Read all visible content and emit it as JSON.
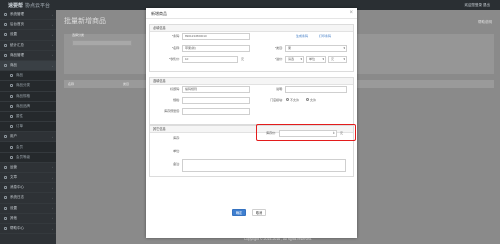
{
  "header": {
    "brand": "速要帮",
    "brand_sub": "协点云平台",
    "user_text": "欢迎您登录 退出"
  },
  "sidebar": {
    "items": [
      {
        "label": "系统管理",
        "type": "top"
      },
      {
        "label": "后台首页",
        "type": "top"
      },
      {
        "label": "设置",
        "type": "top"
      },
      {
        "label": "统计汇总",
        "type": "top"
      },
      {
        "label": "商品管理",
        "type": "top"
      },
      {
        "label": "商品",
        "type": "top",
        "active": true
      },
      {
        "label": "商品",
        "type": "sub"
      },
      {
        "label": "商品分类",
        "type": "sub"
      },
      {
        "label": "商品规格",
        "type": "sub"
      },
      {
        "label": "商品品牌",
        "type": "sub"
      },
      {
        "label": "属性",
        "type": "sub"
      },
      {
        "label": "订单",
        "type": "sub"
      },
      {
        "label": "用户",
        "type": "top"
      },
      {
        "label": "会员",
        "type": "sub"
      },
      {
        "label": "会员等级",
        "type": "sub"
      },
      {
        "label": "运营",
        "type": "top"
      },
      {
        "label": "文章",
        "type": "top"
      },
      {
        "label": "消息中心",
        "type": "top"
      },
      {
        "label": "系统日志",
        "type": "top"
      },
      {
        "label": "设置",
        "type": "top"
      },
      {
        "label": "其他",
        "type": "top"
      },
      {
        "label": "帮助中心",
        "type": "top"
      }
    ]
  },
  "content": {
    "page_title": "批量新增商品",
    "help_link": "帮助说明",
    "bg_label": "选择分类",
    "bg_field_value": "选择分类",
    "table_headers": [
      "名称",
      "类目",
      "",
      "",
      "",
      "",
      "",
      ""
    ]
  },
  "footer": "Copyright © 2015-2016 , All rights reserved.",
  "modal": {
    "title": "新增商品",
    "close": "×",
    "sections": {
      "required": {
        "title": "必填信息",
        "barcode_label": "*条码:",
        "barcode_value": "8901234560010",
        "generate_barcode": "生成条码",
        "print_barcode": "打印条码",
        "name_label": "*名称:",
        "name_value": "苹果(新)",
        "category_label": "*类目:",
        "category_value": "果",
        "price_label": "*零售价:",
        "price_value": "10",
        "price_unit": "元",
        "cost_label": "*进价:",
        "cost_value": "请选",
        "cost_opt2": "单位",
        "cost_opt3": "元"
      },
      "optional": {
        "title": "选填信息",
        "code_label": "标题码:",
        "code_placeholder": "编码规则",
        "desc_label": "说明:",
        "spec_label": "规格:",
        "pos_label": "门店模块:",
        "radio_on": "不允许",
        "radio_off": "允许",
        "supplier_label": "库存预警值:"
      },
      "other": {
        "title": "其它信息",
        "stock_label": "库存:",
        "highlight_label": "库存价:",
        "highlight_unit": "元",
        "unit_label": "单位:",
        "remark_label": "备注:"
      }
    },
    "confirm": "确定",
    "cancel": "取消"
  },
  "colors": {
    "highlight": "#e31c1c",
    "primary": "#3f7fd0",
    "link": "#3a78c3"
  }
}
